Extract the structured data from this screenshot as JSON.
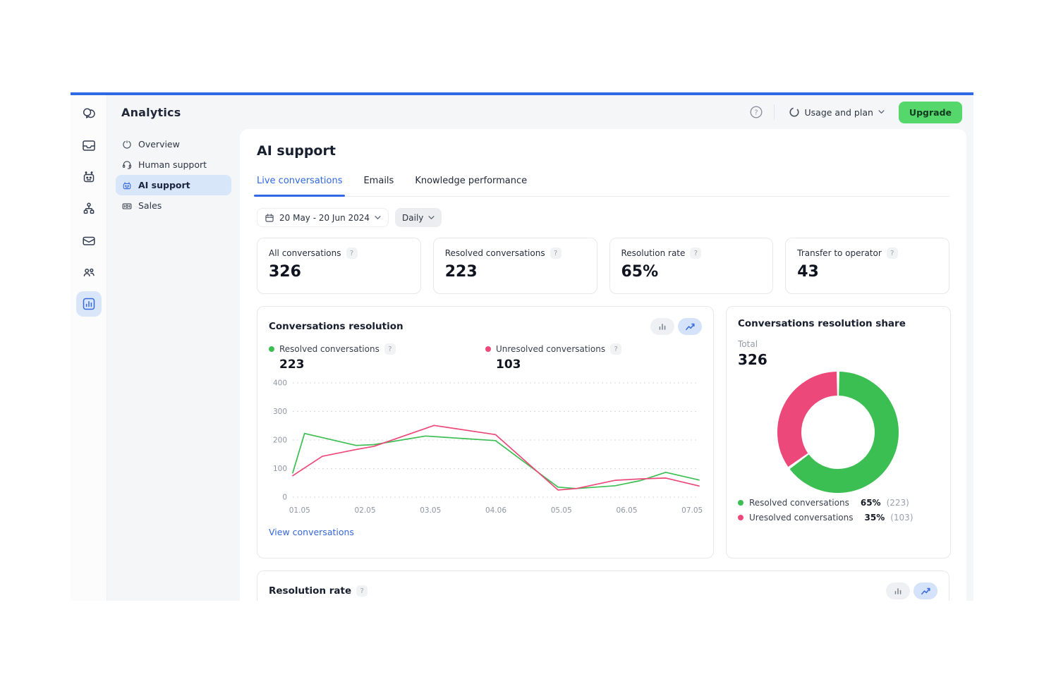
{
  "colors": {
    "accent_blue": "#2d6ae4",
    "link_blue": "#3566d8",
    "green": "#3cbf52",
    "pink": "#ec4879",
    "upgrade_green": "#55d76c",
    "active_item_bg": "#d8e6fa"
  },
  "ui": {
    "help_badge": "?"
  },
  "header": {
    "title": "Analytics",
    "usage_and_plan": "Usage and plan",
    "upgrade": "Upgrade"
  },
  "sidebar": {
    "items": [
      {
        "label": "Overview",
        "icon": "overview-icon",
        "active": false
      },
      {
        "label": "Human support",
        "icon": "headset-icon",
        "active": false
      },
      {
        "label": "AI support",
        "icon": "robot-icon",
        "active": true
      },
      {
        "label": "Sales",
        "icon": "sales-icon",
        "active": false
      }
    ]
  },
  "page": {
    "title": "AI support",
    "tabs": [
      {
        "label": "Live conversations",
        "active": true
      },
      {
        "label": "Emails",
        "active": false
      },
      {
        "label": "Knowledge performance",
        "active": false
      }
    ],
    "filters": {
      "date_range": "20 May - 20 Jun 2024",
      "granularity": "Daily"
    }
  },
  "metrics": [
    {
      "label": "All conversations",
      "value": "326"
    },
    {
      "label": "Resolved conversations",
      "value": "223"
    },
    {
      "label": "Resolution rate",
      "value": "65%"
    },
    {
      "label": "Transfer to operator",
      "value": "43"
    }
  ],
  "resolution_card": {
    "title": "Conversations resolution",
    "legend": [
      {
        "label": "Resolved conversations",
        "value": "223",
        "color": "#3cbf52"
      },
      {
        "label": "Unresolved conversations",
        "value": "103",
        "color": "#ec4879"
      }
    ],
    "link": "View conversations"
  },
  "share_card": {
    "title": "Conversations resolution share",
    "total_label": "Total",
    "total_value": "326",
    "legend": [
      {
        "label": "Resolved conversations",
        "pct": "65%",
        "count": "(223)",
        "color": "#3cbf52"
      },
      {
        "label": "Uresolved conversations",
        "pct": "35%",
        "count": "(103)",
        "color": "#ec4879"
      }
    ]
  },
  "rate_card": {
    "title": "Resolution rate"
  },
  "chart_data": [
    {
      "type": "line",
      "title": "Conversations resolution",
      "x_ticks": [
        "01.05",
        "02.05",
        "03.05",
        "04.06",
        "05.05",
        "06.05",
        "07.05"
      ],
      "x_tick_pct": [
        1.7,
        17.8,
        33.9,
        50,
        66.1,
        82.2,
        98.3
      ],
      "y_ticks": [
        0,
        100,
        200,
        300,
        400
      ],
      "ylim": [
        0,
        400
      ],
      "grid": "dashed-horizontal",
      "legend_position": "top",
      "series": [
        {
          "name": "Resolved conversations",
          "color": "#3cbf52",
          "total": 223,
          "points": [
            [
              0,
              85
            ],
            [
              2.9,
              223
            ],
            [
              15.6,
              181
            ],
            [
              20,
              184
            ],
            [
              32.7,
              214
            ],
            [
              42.3,
              205
            ],
            [
              49.9,
              198
            ],
            [
              65.3,
              35
            ],
            [
              69.8,
              30
            ],
            [
              79.4,
              40
            ],
            [
              85.6,
              58
            ],
            [
              91.8,
              87
            ],
            [
              100,
              60
            ]
          ]
        },
        {
          "name": "Unresolved conversations",
          "color": "#ec4879",
          "total": 103,
          "points": [
            [
              0,
              75
            ],
            [
              7.3,
              143
            ],
            [
              15.6,
              167
            ],
            [
              20,
              178
            ],
            [
              34.8,
              251
            ],
            [
              49.9,
              219
            ],
            [
              65.3,
              25
            ],
            [
              69.8,
              30
            ],
            [
              79.4,
              59
            ],
            [
              85.6,
              64
            ],
            [
              91.8,
              67
            ],
            [
              100,
              39
            ]
          ]
        }
      ]
    },
    {
      "type": "pie",
      "title": "Conversations resolution share",
      "total": 326,
      "donut": true,
      "slices": [
        {
          "label": "Resolved conversations",
          "pct": 65,
          "count": 223,
          "color": "#3cbf52"
        },
        {
          "label": "Uresolved conversations",
          "pct": 35,
          "count": 103,
          "color": "#ec4879"
        }
      ]
    }
  ]
}
